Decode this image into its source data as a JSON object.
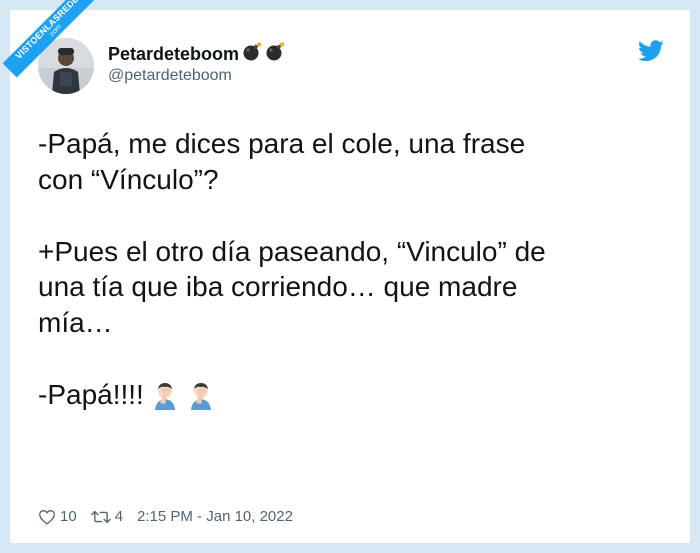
{
  "watermark": {
    "text": "VISTOENLASREDES",
    "sub": ".com"
  },
  "author": {
    "name": "Petardeteboom",
    "handle": "@petardeteboom",
    "name_emojis": [
      "bomb-icon",
      "bomb-icon"
    ]
  },
  "tweet": {
    "line1": "-Papá, me dices para el cole, una frase",
    "line2": "con “Vínculo”?",
    "line3": "+Pues el otro día paseando, “Vinculo” de",
    "line4": "una tía que iba corriendo… que madre",
    "line5": "mía…",
    "line6": "-Papá!!!!"
  },
  "footer": {
    "likes": "10",
    "retweets": "4",
    "timestamp": "2:15 PM - Jan 10, 2022"
  },
  "colors": {
    "background": "#d7e8f5",
    "twitter_blue": "#1da1f2",
    "text": "#0f1419",
    "muted": "#536471"
  }
}
